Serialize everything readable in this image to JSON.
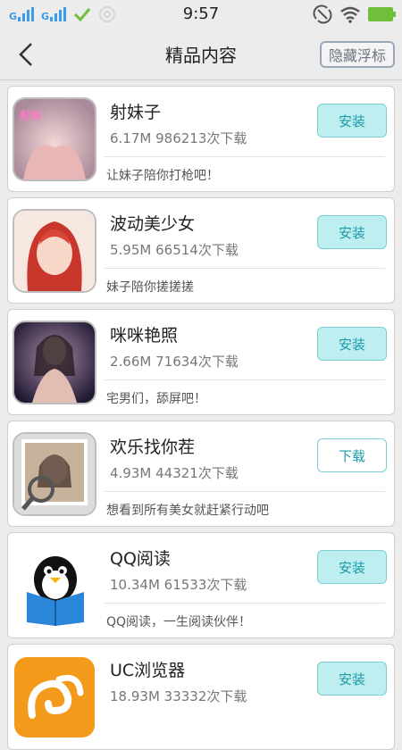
{
  "status_bar": {
    "time": "9:57",
    "signal_letter": "G",
    "icons": [
      "signal-icon",
      "signal-icon",
      "check-icon",
      "settings-circle-icon",
      "rotate-icon",
      "wifi-icon",
      "battery-icon"
    ]
  },
  "header": {
    "title": "精品内容",
    "hide_float_label": "隐藏浮标",
    "back_icon": "chevron-left-icon"
  },
  "apps": [
    {
      "name": "射妹子",
      "size": "6.17M",
      "downloads": "986213次下载",
      "desc": "让妹子陪你打枪吧！",
      "action": "安装",
      "icon": "app-photo-icon"
    },
    {
      "name": "波动美少女",
      "size": "5.95M",
      "downloads": "66514次下载",
      "desc": "妹子陪你搓搓搓",
      "action": "安装",
      "icon": "anime-girl-icon"
    },
    {
      "name": "咪咪艳照",
      "size": "2.66M",
      "downloads": "71634次下载",
      "desc": "宅男们，舔屏吧！",
      "action": "安装",
      "icon": "app-photo-icon"
    },
    {
      "name": "欢乐找你茬",
      "size": "4.93M",
      "downloads": "44321次下载",
      "desc": "想看到所有美女就赶紧行动吧",
      "action": "下载",
      "icon": "magnifier-photo-icon"
    },
    {
      "name": "QQ阅读",
      "size": "10.34M",
      "downloads": "61533次下载",
      "desc": "QQ阅读，一生阅读伙伴！",
      "action": "安装",
      "icon": "penguin-book-icon"
    },
    {
      "name": "UC浏览器",
      "size": "18.93M",
      "downloads": "33332次下载",
      "desc": "",
      "action": "安装",
      "icon": "uc-squirrel-icon"
    }
  ],
  "colors": {
    "accent": "#1c9aa8",
    "install_bg": "#bfeef0",
    "battery": "#6fbf3a",
    "signal": "#3c9be8"
  }
}
